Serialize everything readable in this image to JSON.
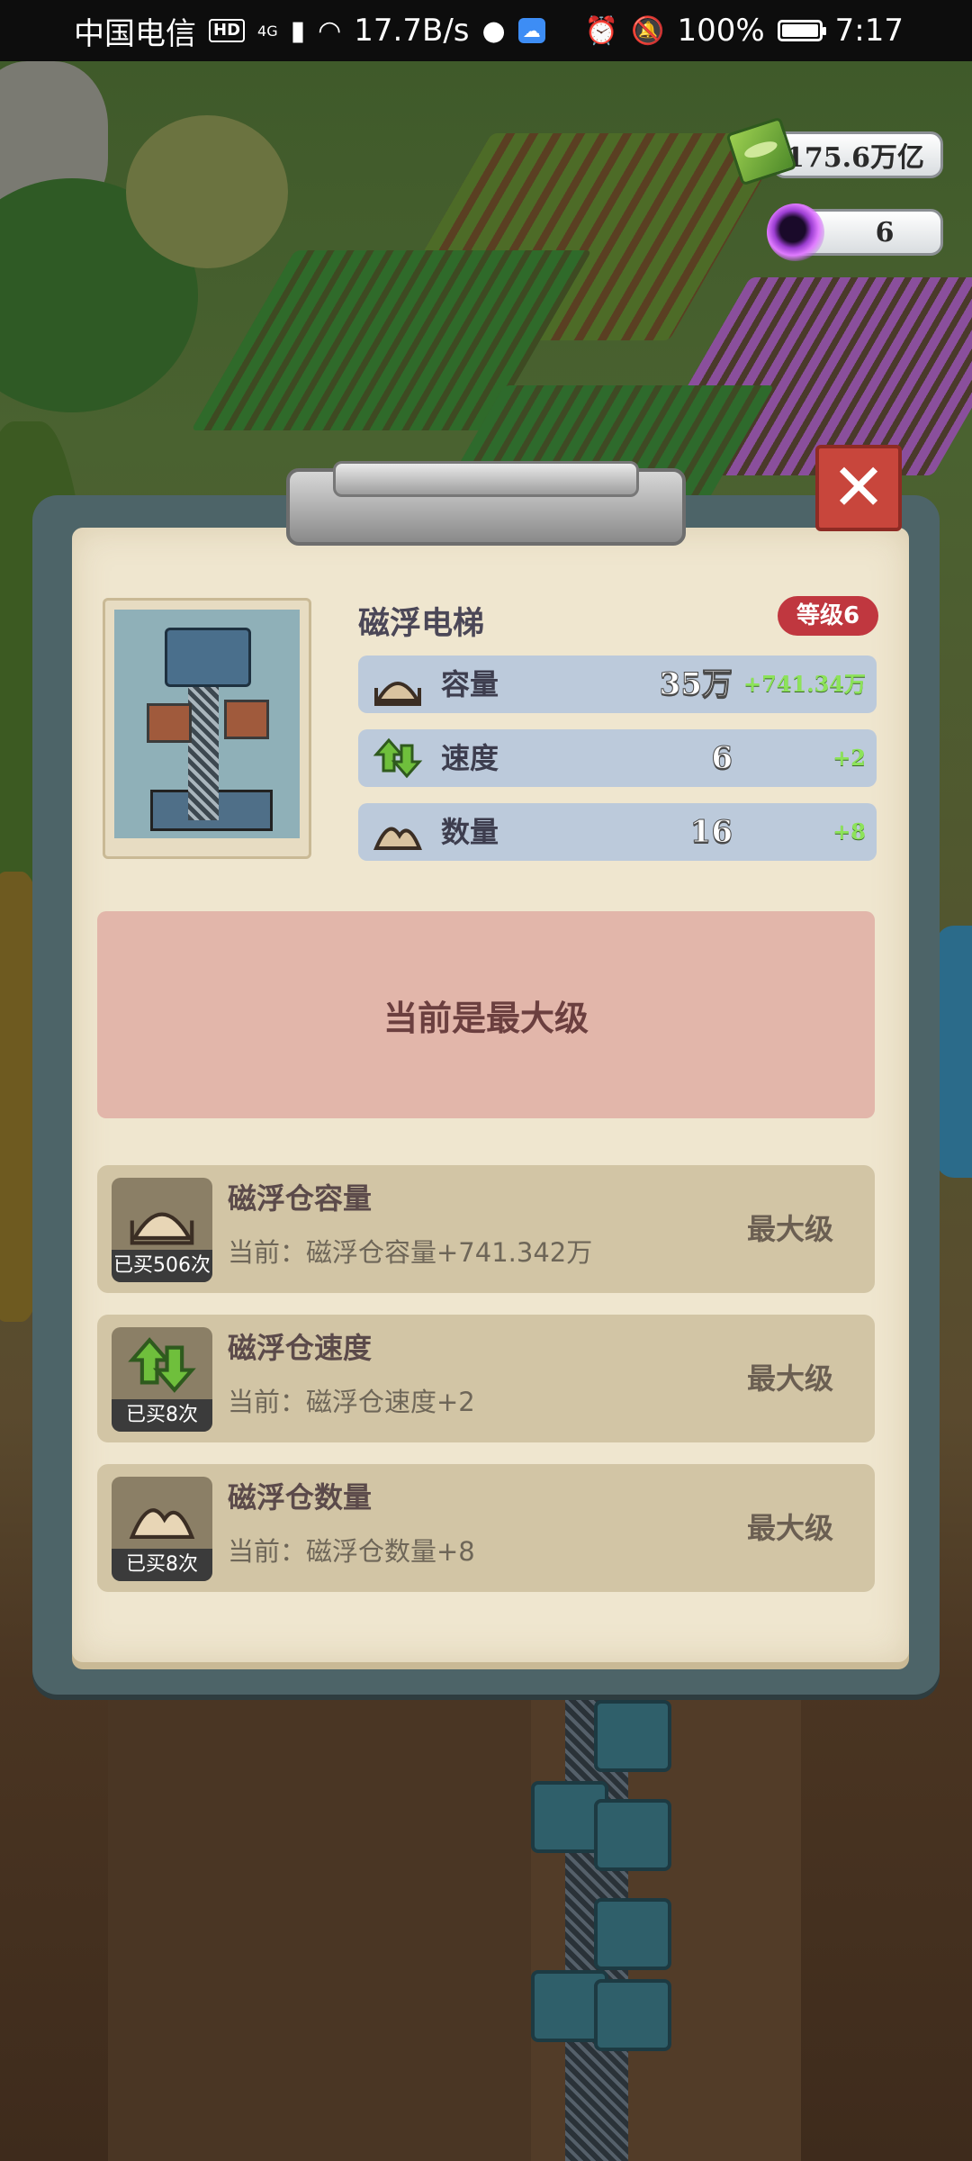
{
  "status_bar": {
    "carrier": "中国电信",
    "hd": "HD",
    "network": "4G",
    "speed": "17.7B/s",
    "battery": "100%",
    "time": "7:17"
  },
  "currency": {
    "cash": "175.6万亿",
    "gems": "6"
  },
  "dialog": {
    "title": "磁浮电梯",
    "level": "等级6",
    "stats": [
      {
        "icon": "capacity-icon",
        "label": "容量",
        "value": "35万",
        "bonus": "+741.34万"
      },
      {
        "icon": "speed-icon",
        "label": "速度",
        "value": "6",
        "bonus": "+2"
      },
      {
        "icon": "quantity-icon",
        "label": "数量",
        "value": "16",
        "bonus": "+8"
      }
    ],
    "max_level_message": "当前是最大级",
    "upgrades": [
      {
        "icon": "capacity-icon",
        "title": "磁浮仓容量",
        "bought": "已买506次",
        "desc": "当前：磁浮仓容量+741.342万",
        "action": "最大级"
      },
      {
        "icon": "speed-icon",
        "title": "磁浮仓速度",
        "bought": "已买8次",
        "desc": "当前：磁浮仓速度+2",
        "action": "最大级"
      },
      {
        "icon": "quantity-icon",
        "title": "磁浮仓数量",
        "bought": "已买8次",
        "desc": "当前：磁浮仓数量+8",
        "action": "最大级"
      }
    ]
  },
  "colors": {
    "level_badge": "#c0373f",
    "bonus_green": "#8de35a",
    "max_panel": "#e2b6aa",
    "close_button": "#c8463c"
  }
}
